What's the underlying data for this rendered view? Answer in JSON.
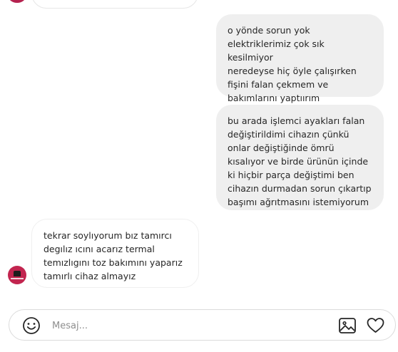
{
  "messages": [
    {
      "direction": "incoming",
      "text": ""
    },
    {
      "direction": "outgoing",
      "text": "o yönde sorun yok\nelektriklerimiz çok sık kesilmiyor\nneredeyse hiç öyle çalışırken\nfişini falan çekmem ve\nbakımlarını yaptıırım"
    },
    {
      "direction": "outgoing",
      "text": "bu arada işlemci ayakları falan\ndeğiştirildimi cihazın çünkü\nonlar değiştiğinde ömrü\nkısalıyor ve birde ürünün içinde\nki hiçbir parça değiştimi ben\ncihazın durmadan sorun çıkartıp\nbaşımı ağrıtmasını istemiyorum"
    },
    {
      "direction": "incoming",
      "text": "tekrar soylıyorum bız tamırcı\ndegılız ıcını acarız termal\ntemızlıgını toz bakımını yaparız\ntamırlı cihaz almayız"
    }
  ],
  "composer": {
    "placeholder": "Mesaj...",
    "value": ""
  },
  "icons": {
    "emoji": "emoji-icon",
    "image": "image-icon",
    "heart": "heart-icon"
  },
  "colors": {
    "outgoing_bubble": "#efefef",
    "incoming_border": "#efefef",
    "avatar": "#c2254f",
    "text": "#262626",
    "placeholder": "#8e8e8e"
  }
}
